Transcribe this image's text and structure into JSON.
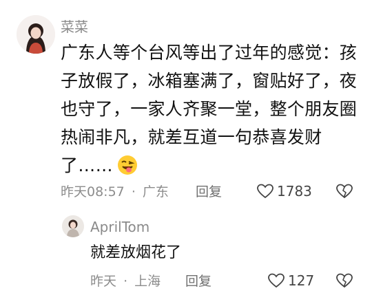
{
  "comment": {
    "author": "菜菜",
    "text": "广东人等个台风等出了过年的感觉：孩子放假了，冰箱塞满了，窗贴好了，夜也守了，一家人齐聚一堂，整个朋友圈热闹非凡，就差互道一句恭喜发财了……",
    "emoji": "face-with-tongue-wink-icon",
    "time": "昨天08:57",
    "separator": "·",
    "location": "广东",
    "reply_label": "回复",
    "likes": "1783"
  },
  "reply": {
    "author": "AprilTom",
    "text": "就差放烟花了",
    "time": "昨天",
    "separator": "·",
    "location": "上海",
    "reply_label": "回复",
    "likes": "127"
  },
  "colors": {
    "name": "#8a8a8a",
    "meta": "#8c8c8c",
    "text": "#111111"
  }
}
